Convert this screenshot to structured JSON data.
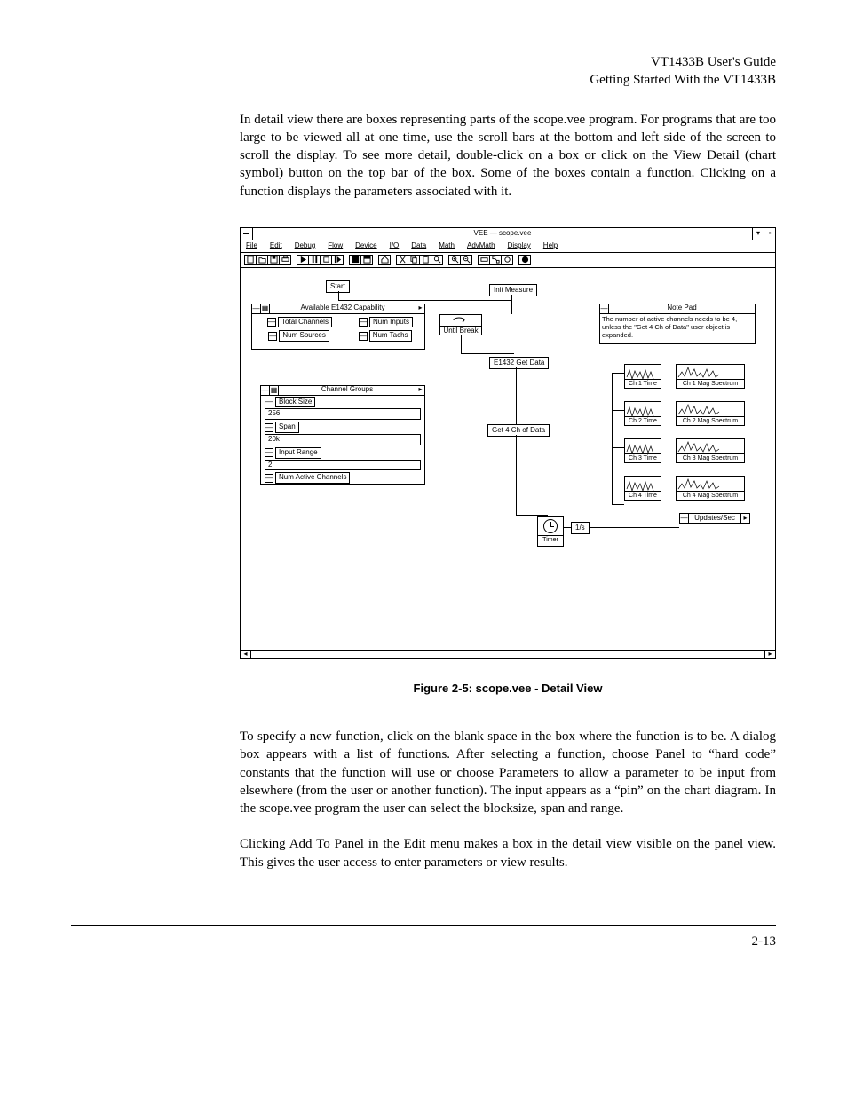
{
  "header": {
    "line1": "VT1433B User's Guide",
    "line2": "Getting Started With the VT1433B"
  },
  "para1": "In detail view there are boxes representing parts of the scope.vee program.  For programs that are too large to be viewed all at one time, use the scroll bars at the bottom and left side of the screen to scroll the display.  To see more detail, double-click on a box or click on the View Detail (chart symbol) button on the top bar of the box.  Some of the boxes contain a function.  Clicking on a function displays the parameters associated with it.",
  "figcaption": "Figure 2-5: scope.vee - Detail View",
  "para2": "To specify a new function, click on the blank space in the box where the function is to be.  A dialog box appears with a list of functions.  After selecting a function, choose Panel to “hard code” constants that the function will use or choose Parameters to allow a parameter to be input from elsewhere (from the user or another function).   The input appears as a “pin” on the chart diagram.  In the scope.vee program the user can select the blocksize, span and range.",
  "para3": "Clicking Add To Panel in the Edit menu makes a box in the detail view visible on the panel view.   This gives the user access to enter parameters or view results.",
  "pagenum": "2-13",
  "vee": {
    "title": "VEE — scope.vee",
    "menus": [
      "File",
      "Edit",
      "Debug",
      "Flow",
      "Device",
      "I/O",
      "Data",
      "Math",
      "AdvMath",
      "Display",
      "Help"
    ],
    "start": "Start",
    "init_measure": "Init Measure",
    "until_break": "Until Break",
    "e1432_get": "E1432 Get Data",
    "get4ch": "Get 4 Ch of Data",
    "timer": "Timer",
    "timer_val": "1/s",
    "updates": "Updates/Sec",
    "notepad_title": "Note Pad",
    "notepad_body": "The number of active channels needs to be 4, unless the \"Get 4 Ch of Data\" user object is expanded.",
    "cap_title": "Available E1432 Capability",
    "cap_total": "Total Channels",
    "cap_inputs": "Num Inputs",
    "cap_sources": "Num Sources",
    "cap_tachs": "Num Tachs",
    "groups_title": "Channel Groups",
    "block_size": "Block Size",
    "block_size_val": "256",
    "span": "Span",
    "span_val": "20k",
    "input_range": "Input Range",
    "input_range_val": "2",
    "num_active": "Num Active Channels",
    "plots": {
      "ch1t": "Ch 1 Time",
      "ch1m": "Ch 1 Mag Spectrum",
      "ch2t": "Ch 2 Time",
      "ch2m": "Ch 2 Mag Spectrum",
      "ch3t": "Ch 3 Time",
      "ch3m": "Ch 3 Mag Spectrum",
      "ch4t": "Ch 4 Time",
      "ch4m": "Ch 4 Mag Spectrum"
    }
  }
}
